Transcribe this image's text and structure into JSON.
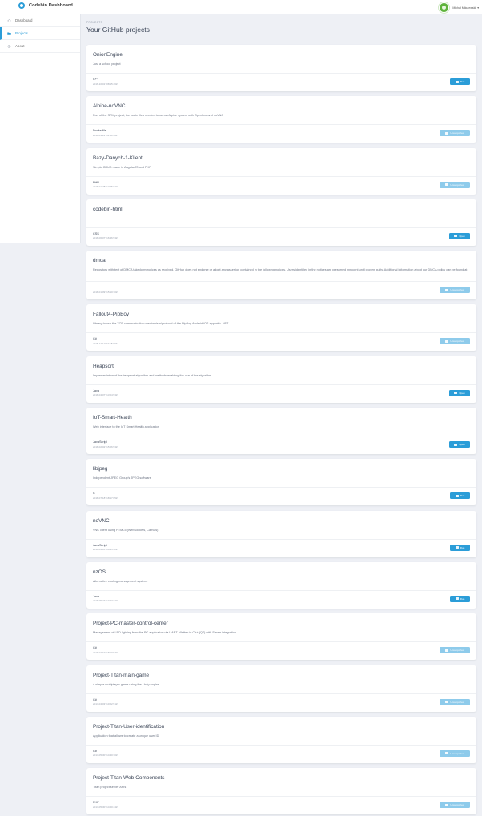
{
  "header": {
    "brand": "Codebin Dashboard",
    "user_name": "Michał Mikulewski",
    "colors": {
      "accent": "#2b9dd8",
      "avatar": "#5fb33c"
    }
  },
  "sidebar": {
    "items": [
      {
        "label": "Dashboard",
        "icon": "home-icon",
        "active": false
      },
      {
        "label": "Projects",
        "icon": "folder-icon",
        "active": true
      },
      {
        "label": "About",
        "icon": "info-icon",
        "active": false
      }
    ]
  },
  "main": {
    "overline": "PROJECTS",
    "title": "Your GitHub projects"
  },
  "projects": [
    {
      "name": "OnionEngine",
      "description": "Just a school project",
      "language": "C++",
      "date": "2016-10-01T08:15:46Z",
      "action": "Run",
      "status": "run"
    },
    {
      "name": "Alpine-noVNC",
      "description": "Part of the SRV project, the basic files needed to run an Alpine system with Openbox and noVNC",
      "language": "Dockerfile",
      "date": "2018-03-22T11:46:33Z",
      "action": "Unsupported",
      "status": "unsupported"
    },
    {
      "name": "Bazy-Danych-1-Klient",
      "description": "Simple CRUD made in AngularJS and PHP",
      "language": "PHP",
      "date": "2018-01-28T13:55:02Z",
      "action": "Unsupported",
      "status": "unsupported"
    },
    {
      "name": "codebin-html",
      "description": "",
      "language": "CSS",
      "date": "2018-06-07T16:46:53Z",
      "action": "Open",
      "status": "open"
    },
    {
      "name": "dmca",
      "description": "Repository with text of DMCA takedown notices as received. GitHub does not endorse or adopt any assertion contained in the following notices. Users identified in the notices are presumed innocent until proven guilty. Additional information about our DMCA policy can be found at",
      "language": "",
      "date": "2018-01-09T15:10:30Z",
      "action": "Unsupported",
      "status": "unsupported"
    },
    {
      "name": "Fallout4-PipBoy",
      "description": "Library to use the TCP communication mechanism/protocol of the PipBoy Android/iOS app with .NET",
      "language": "C#",
      "date": "2015-12-11T19:18:00Z",
      "action": "Unsupported",
      "status": "unsupported"
    },
    {
      "name": "Heapsort",
      "description": "Implementation of the heapsort algorithm and methods enabling the use of the algorithm.",
      "language": "Java",
      "date": "2018-04-07T13:04:53Z",
      "action": "Open",
      "status": "open"
    },
    {
      "name": "IoT-Smart-Health",
      "description": "Web interface to the IoT Smart Health application",
      "language": "JavaScript",
      "date": "2018-02-02T15:06:53Z",
      "action": "Open",
      "status": "open"
    },
    {
      "name": "libjpeg",
      "description": "Independent JPEG Group's JPEG software",
      "language": "C",
      "date": "2018-07-18T18:17:05Z",
      "action": "Run",
      "status": "run"
    },
    {
      "name": "noVNC",
      "description": "VNC client using HTML5 (WebSockets, Canvas)",
      "language": "JavaScript",
      "date": "2018-04-18T08:35:42Z",
      "action": "Run",
      "status": "run"
    },
    {
      "name": "nzOS",
      "description": "Alternative cooling management system.",
      "language": "Java",
      "date": "2018-05-24T17:37:32Z",
      "action": "Run",
      "status": "run"
    },
    {
      "name": "Project-PC-master-control-center",
      "description": "Management of LED lighting from the PC application via UART. Written in C++ (QT) with Steam integration.",
      "language": "C#",
      "date": "2016-02-19T18:10:57Z",
      "action": "Unsupported",
      "status": "unsupported"
    },
    {
      "name": "Project-Titan-main-game",
      "description": "A simple multiplayer game using the Unity engine",
      "language": "C#",
      "date": "2017-04-03T10:22:51Z",
      "action": "Unsupported",
      "status": "unsupported"
    },
    {
      "name": "Project-Titan-User-identification",
      "description": "Application that allows to create a unique user ID",
      "language": "C#",
      "date": "2017-05-30T14:40:30Z",
      "action": "Unsupported",
      "status": "unsupported"
    },
    {
      "name": "Project-Titan-Web-Components",
      "description": "Titan project server APIs",
      "language": "PHP",
      "date": "2017-05-30T14:50:44Z",
      "action": "Unsupported",
      "status": "unsupported"
    }
  ]
}
